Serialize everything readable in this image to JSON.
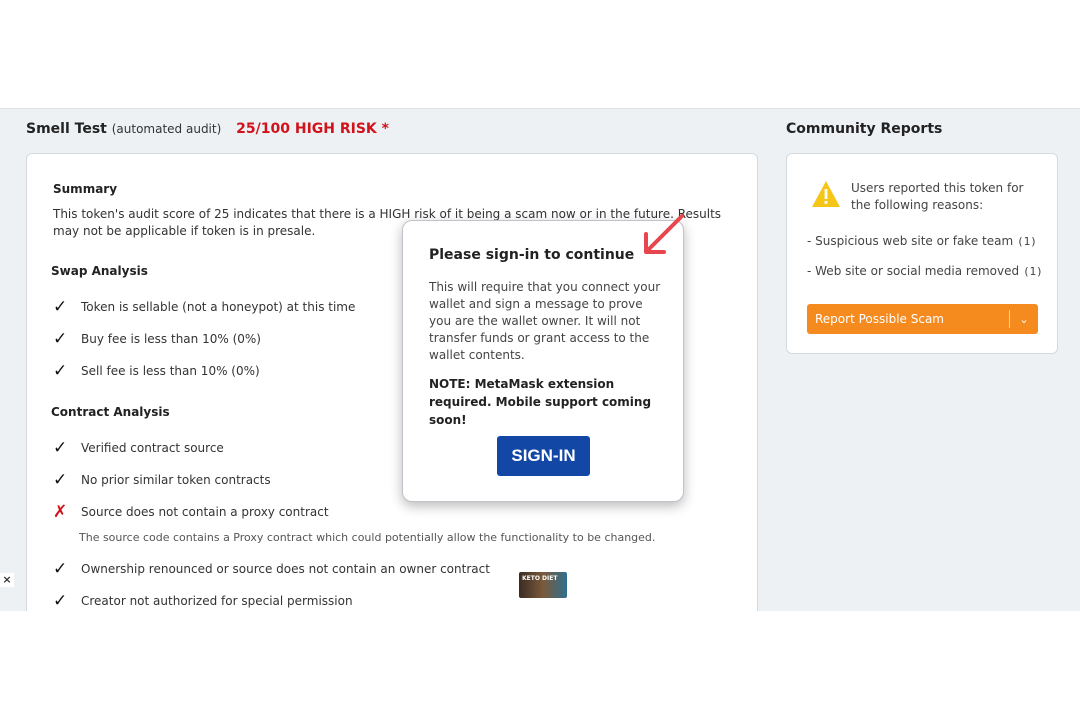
{
  "left": {
    "heading": "Smell Test",
    "heading_sub": "(automated audit)",
    "risk": "25/100 HIGH RISK *",
    "summary_title": "Summary",
    "summary_text": "This token's audit score of 25 indicates that there is a HIGH risk of it being a scam now or in the future. Results may not be applicable if token is in presale.",
    "swap_title": "Swap Analysis",
    "swap_items": [
      "Token is sellable (not a honeypot) at this time",
      "Buy fee is less than 10% (0%)",
      "Sell fee is less than 10% (0%)"
    ],
    "contract_title": "Contract Analysis",
    "contract_items": [
      "Verified contract source",
      "No prior similar token contracts",
      "Source does not contain a proxy contract",
      "Ownership renounced or source does not contain an owner contract",
      "Creator not authorized for special permission"
    ],
    "proxy_note": "The source code contains a Proxy contract which could potentially allow the functionality to be changed.",
    "ad_text": "KETO DIET"
  },
  "right": {
    "heading": "Community Reports",
    "report_text": "Users reported this token for the following reasons:",
    "reasons": [
      {
        "label": "- Suspicious web site or fake team",
        "count": "(1)"
      },
      {
        "label": "- Web site or social media removed",
        "count": "(1)"
      }
    ],
    "report_button": "Report Possible Scam"
  },
  "modal": {
    "title": "Please sign-in to continue",
    "body": "This will require that you connect your wallet and sign a message to prove you are the wallet owner. It will not transfer funds or grant access to the wallet contents.",
    "note": "NOTE: MetaMask extension required. Mobile support coming soon!",
    "button": "SIGN-IN"
  },
  "close_label": "×",
  "colors": {
    "risk": "#d0121b",
    "accent_button": "#f58a1f",
    "signin": "#1347a6",
    "warning": "#f5c518",
    "arrow": "#e8464e"
  }
}
